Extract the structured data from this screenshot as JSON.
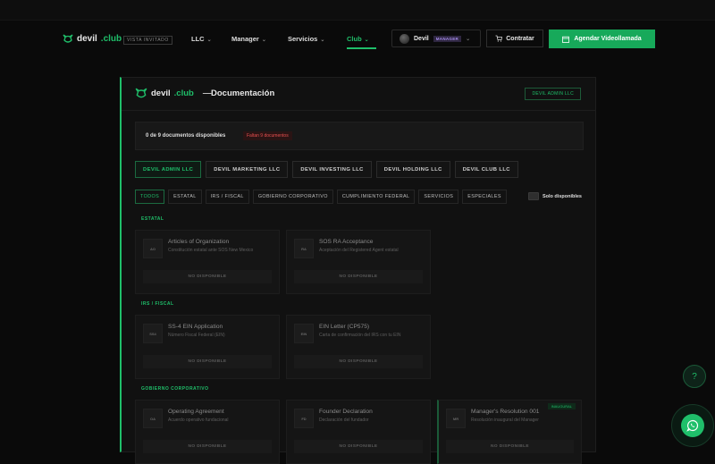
{
  "brand": {
    "name": "devil",
    "tld": ".club",
    "badge": "VISTA INVITADO"
  },
  "nav": [
    {
      "label": "LLC",
      "active": false
    },
    {
      "label": "Manager",
      "active": false
    },
    {
      "label": "Servicios",
      "active": false
    },
    {
      "label": "Club",
      "active": true
    }
  ],
  "user": {
    "name": "Devil",
    "role": "MANAGER"
  },
  "actions": {
    "contratar": "Contratar",
    "agendar": "Agendar Videollamada"
  },
  "panel": {
    "separator": "—",
    "title": "Documentación",
    "tag": "DEVIL ADMIN LLC",
    "summary": {
      "count": "0 de 9 documentos disponibles",
      "missing": "Faltan 9 documentos"
    },
    "llcs": [
      "DEVIL ADMIN LLC",
      "DEVIL MARKETING LLC",
      "DEVIL INVESTING LLC",
      "DEVIL HOLDING LLC",
      "DEVIL CLUB LLC"
    ],
    "tabs": [
      "TODOS",
      "ESTATAL",
      "IRS / FISCAL",
      "GOBIERNO CORPORATIVO",
      "CUMPLIMIENTO FEDERAL",
      "SERVICIOS",
      "ESPECIALES"
    ],
    "solo_label": "Solo disponibles",
    "unavailable": "NO DISPONIBLE",
    "sections": [
      {
        "label": "ESTATAL",
        "docs": [
          {
            "code": "AO",
            "title": "Articles of Organization",
            "sub": "Constitución estatal ante SOS New Mexico"
          },
          {
            "code": "RA",
            "title": "SOS RA Acceptance",
            "sub": "Aceptación del Registered Agent estatal"
          }
        ]
      },
      {
        "label": "IRS / FISCAL",
        "docs": [
          {
            "code": "SS4",
            "title": "SS-4 EIN Application",
            "sub": "Número Fiscal Federal (EIN)"
          },
          {
            "code": "EIN",
            "title": "EIN Letter (CP575)",
            "sub": "Carta de confirmación del IRS con tu EIN"
          }
        ]
      },
      {
        "label": "GOBIERNO CORPORATIVO",
        "docs": [
          {
            "code": "OA",
            "title": "Operating Agreement",
            "sub": "Acuerdo operativo fundacional"
          },
          {
            "code": "FD",
            "title": "Founder Declaration",
            "sub": "Declaración del fundador"
          },
          {
            "code": "MR",
            "title": "Manager's Resolution 001",
            "sub": "Resolución inaugural del Manager",
            "badge": "INAUGURAL"
          }
        ]
      }
    ]
  }
}
